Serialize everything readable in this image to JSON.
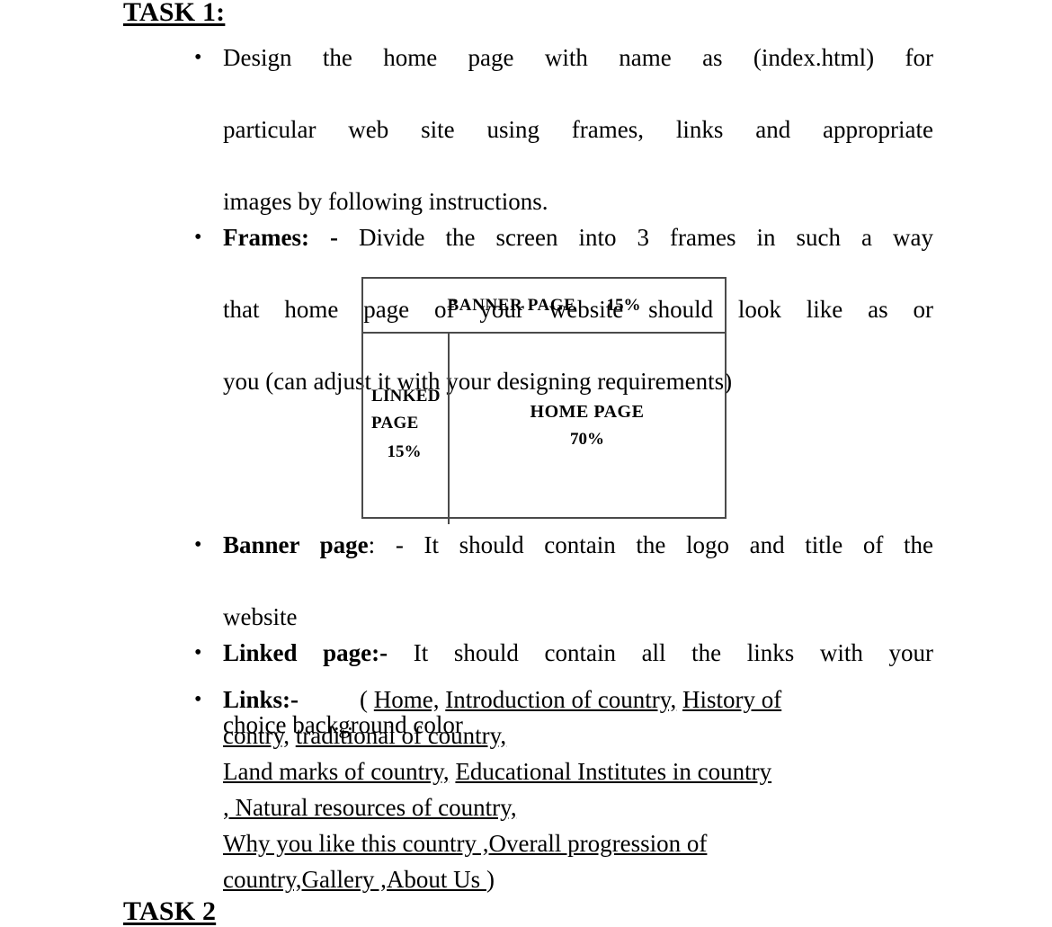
{
  "document": {
    "task1_heading": "TASK 1:",
    "task2_heading": "TASK 2",
    "bullets": [
      {
        "name": "design-home-page",
        "label": "",
        "text": "Design the home page with name as (index.html) for particular web site using frames, links and appropriate images by following instructions.",
        "line1": "Design the home page with name as (index.html) for",
        "line2": "particular web site using frames, links and appropriate",
        "line3": "images by following instructions."
      },
      {
        "name": "frames",
        "label": "Frames: -",
        "text": "Divide the screen into 3 frames in such a way that home page of your website should look like as or you (can adjust it with your designing requirements)",
        "line1": "Divide the screen into 3 frames in such a way",
        "line2": "that home page of your website should look like as or",
        "line3": "you (can adjust it with your designing requirements)"
      },
      {
        "name": "banner-page",
        "label": "Banner page",
        "separator": ": - ",
        "text": "It should contain the logo and title of the website",
        "line1": "It should contain the logo and title of the",
        "line2": "website"
      },
      {
        "name": "linked-page",
        "label": "Linked page:-",
        "text": "It should contain all the links with your choice background color",
        "line1": "It should contain all the links with your",
        "line2": "choice background color"
      }
    ],
    "diagram": {
      "banner": {
        "title": "BANNER PAGE",
        "percent": "15%"
      },
      "linked": {
        "title_line1": "LINKED",
        "title_line2": "PAGE",
        "percent": "15%"
      },
      "home": {
        "title": "HOME PAGE",
        "percent": "70%"
      }
    },
    "links_section": {
      "label": "Links:-",
      "open_paren": "(",
      "close_paren": ")",
      "items": [
        "Home",
        "Introduction of country",
        "History of contry",
        "traditional of country",
        "Land marks of country",
        "Educational Institutes in country",
        "Natural resources of country",
        "Why you like this country",
        "Overall progression of country",
        "Gallery",
        "About Us"
      ],
      "line1_a": "Home,",
      "line1_b": "Introduction of country,",
      "line1_c": "History of",
      "line2_a": "contry,",
      "line2_b": "traditional of country,",
      "line3_a": "Land marks of country,",
      "line3_b": "Educational Institutes in country",
      "line4": ", Natural resources of country,",
      "line5": "Why you like this country ,Overall progression of",
      "line6": "country,Gallery ,About Us "
    }
  }
}
